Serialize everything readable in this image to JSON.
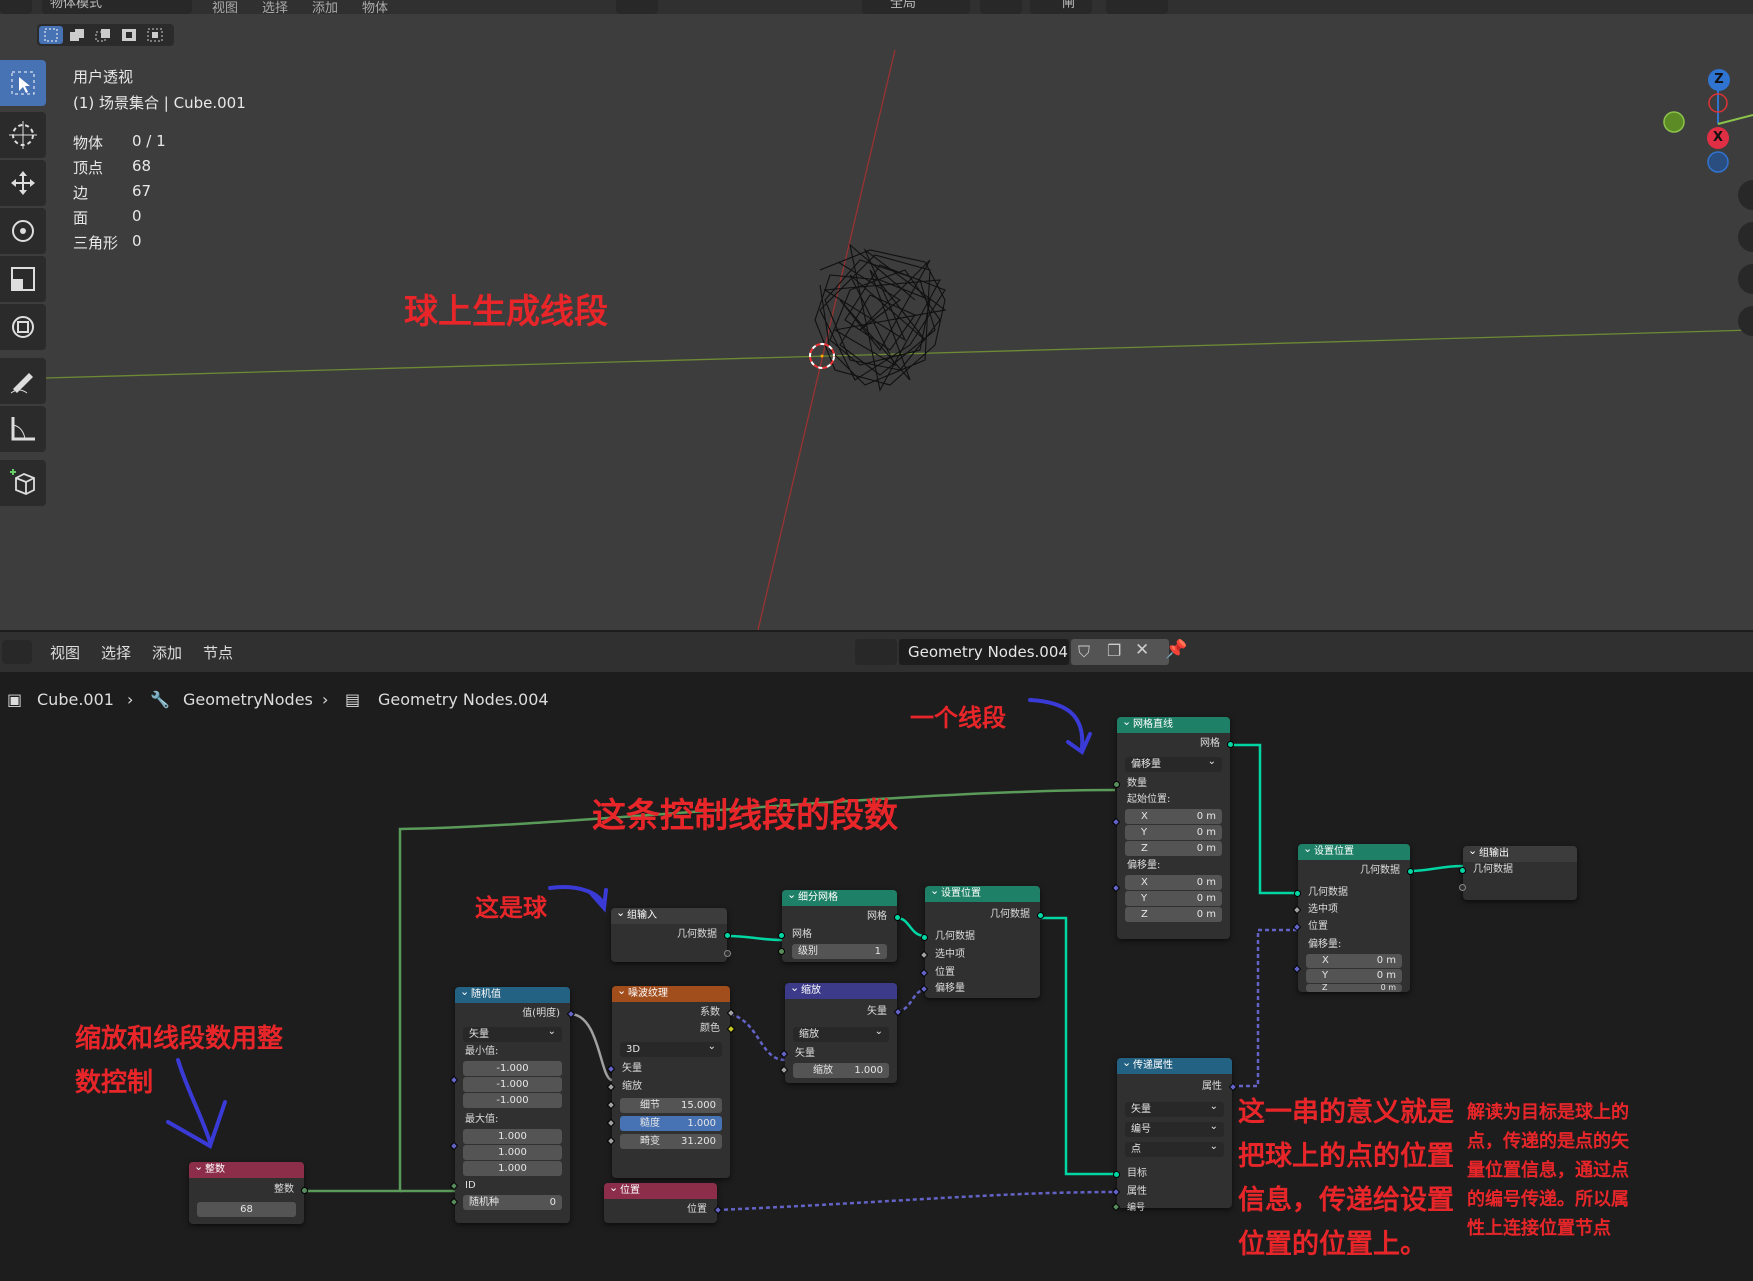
{
  "viewport": {
    "header": {
      "mode": "物体模式",
      "menus": [
        "视图",
        "选择",
        "添加",
        "物体"
      ],
      "transform": "全局",
      "snap": "闸"
    },
    "view_name": "用户透视",
    "scene_line": "(1) 场景集合 | Cube.001",
    "stats": [
      {
        "label": "物体",
        "value": "0 / 1"
      },
      {
        "label": "顶点",
        "value": "68"
      },
      {
        "label": "边",
        "value": "67"
      },
      {
        "label": "面",
        "value": "0"
      },
      {
        "label": "三角形",
        "value": "0"
      }
    ],
    "annotation": "球上生成线段",
    "gizmo": {
      "z": "Z",
      "x": "X"
    }
  },
  "node_header": {
    "menus": [
      "视图",
      "选择",
      "添加",
      "节点"
    ],
    "tree_name": "Geometry Nodes.004"
  },
  "breadcrumb": {
    "object": "Cube.001",
    "modifier": "GeometryNodes",
    "tree": "Geometry Nodes.004"
  },
  "nodes": {
    "group_input": {
      "title": "组输入",
      "geo": "几何数据"
    },
    "subdivide": {
      "title": "细分网格",
      "mesh_out": "网格",
      "mesh_in": "网格",
      "level_label": "级别",
      "level": "1"
    },
    "set_position1": {
      "title": "设置位置",
      "geo_out": "几何数据",
      "geo": "几何数据",
      "sel": "选中项",
      "pos": "位置",
      "offset": "偏移量"
    },
    "mesh_line": {
      "title": "网格直线",
      "mesh": "网格",
      "mode": "偏移量",
      "count": "数量",
      "start": "起始位置:",
      "offset": "偏移量:",
      "sx": "0 m",
      "sy": "0 m",
      "sz": "0 m",
      "ox": "0 m",
      "oy": "0 m",
      "oz": "0 m"
    },
    "set_position2": {
      "title": "设置位置",
      "geo_out": "几何数据",
      "geo": "几何数据",
      "sel": "选中项",
      "pos": "位置",
      "offset": "偏移量:",
      "x": "0 m",
      "y": "0 m",
      "z": "0 m"
    },
    "group_output": {
      "title": "组输出",
      "geo": "几何数据"
    },
    "random": {
      "title": "随机值",
      "out": "值(明度)",
      "type": "矢量",
      "min": "最小值:",
      "min_vals": [
        "-1.000",
        "-1.000",
        "-1.000"
      ],
      "max": "最大值:",
      "max_vals": [
        "1.000",
        "1.000",
        "1.000"
      ],
      "id": "ID",
      "seed_label": "随机种",
      "seed": "0"
    },
    "noise": {
      "title": "噪波纹理",
      "fac": "系数",
      "color": "颜色",
      "dim": "3D",
      "vec": "矢量",
      "scale": "缩放",
      "detail_label": "细节",
      "detail": "15.000",
      "rough_label": "糙度",
      "rough": "1.000",
      "distort_label": "畸变",
      "distort": "31.200"
    },
    "scale": {
      "title": "缩放",
      "out": "矢量",
      "op": "缩放",
      "vec": "矢量",
      "scale_label": "缩放",
      "scale": "1.000"
    },
    "transfer": {
      "title": "传递属性",
      "attr_out": "属性",
      "type": "矢量",
      "mode": "编号",
      "domain": "点",
      "target": "目标",
      "attr": "属性",
      "index": "编号"
    },
    "integer": {
      "title": "整数",
      "out": "整数",
      "value": "68"
    },
    "position": {
      "title": "位置",
      "out": "位置"
    }
  },
  "annotations": {
    "one_segment": "一个线段",
    "segments": "这条控制线段的段数",
    "sphere": "这是球",
    "int_ctrl_1": "缩放和线段数用整",
    "int_ctrl_2": "数控制",
    "meaning": [
      "这一串的意义就是",
      "把球上的点的位置",
      "信息，传递给设置",
      "位置的位置上。"
    ],
    "explain": [
      "解读为目标是球上的",
      "点，传递的是点的矢",
      "量位置信息，通过点",
      "的编号传递。所以属",
      "性上连接位置节点"
    ]
  },
  "colors": {
    "annotation_red": "#e8262a",
    "arrow_blue": "#3a3ad6",
    "geo_wire": "#00d6a3",
    "int_wire": "#5a9b5a",
    "vec_wire": "#6363c7",
    "active_blue": "#4772b3"
  }
}
